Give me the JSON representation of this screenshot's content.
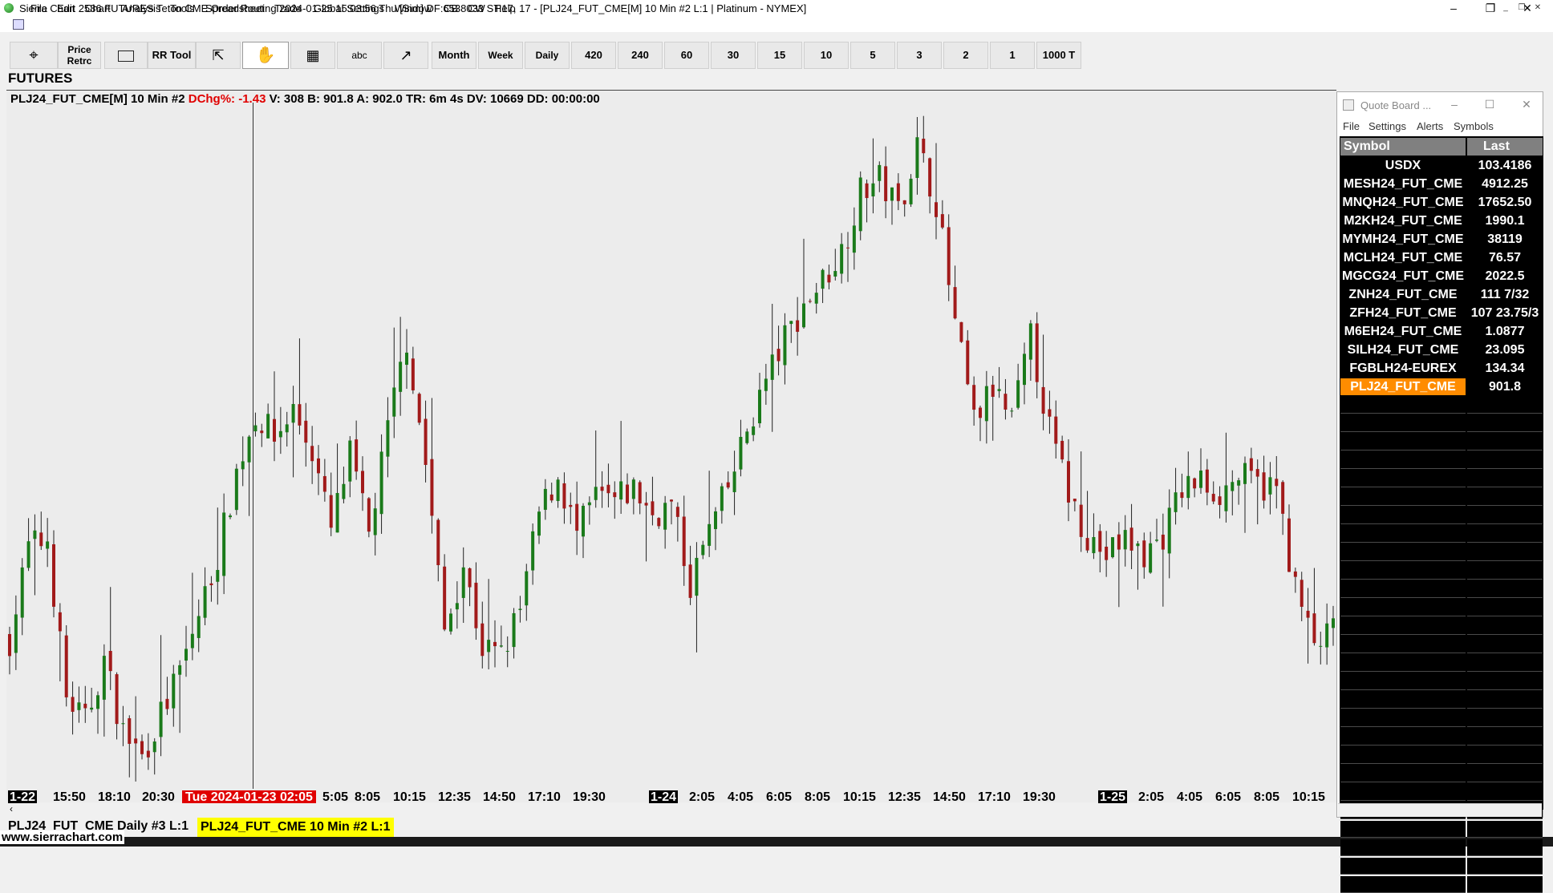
{
  "window": {
    "title": "Sierra Chart 2586 FUTURES Teton CME Order Routing 2024-01-25  15:03:56 Thu [Sim]  DF:6538033  ST:17, 17 - [PLJ24_FUT_CME[M]  10 Min  #2 L:1 | Platinum - NYMEX]",
    "minimize": "–",
    "maximize": "❐",
    "close": "✕"
  },
  "menu": {
    "items": [
      "File",
      "Edit",
      "Chart",
      "Analysis",
      "Tools",
      "Spreadsheet",
      "Trade",
      "Global Settings",
      "Window",
      "CB",
      "CW",
      "Help"
    ]
  },
  "toolbar": {
    "price_retrc_line1": "Price",
    "price_retrc_line2": "Retrc",
    "rr_tool": "RR Tool",
    "text_tool": "abc",
    "timeframes": [
      "Month",
      "Week",
      "Daily",
      "420",
      "240",
      "60",
      "30",
      "15",
      "10",
      "5",
      "3",
      "2",
      "1",
      "1000 T"
    ]
  },
  "chart": {
    "group_label": "FUTURES",
    "study_symbol": "PLJ24_FUT_CME[M]  10 Min  #2",
    "study_dchg": "DChg%: -1.43",
    "study_rest": "V: 308 B: 901.8 A: 902.0 TR: 6m 4s DV: 10669 DD: 00:00:00",
    "x_labels": [
      "1-22",
      "15:50",
      "18:10",
      "20:30",
      "Tue 2024-01-23  02:05",
      "5:05",
      "8:05",
      "10:15",
      "12:35",
      "14:50",
      "17:10",
      "19:30",
      "1-24",
      "2:05",
      "4:05",
      "6:05",
      "8:05",
      "10:15",
      "12:35",
      "14:50",
      "17:10",
      "19:30",
      "1-25",
      "2:05",
      "4:05",
      "6:05",
      "8:05",
      "10:15"
    ]
  },
  "chart_data": {
    "type": "candlestick",
    "symbol": "PLJ24_FUT_CME",
    "interval": "10 Min",
    "anchors": [
      [
        0,
        880
      ],
      [
        3,
        902
      ],
      [
        6,
        904
      ],
      [
        9,
        866
      ],
      [
        12,
        860
      ],
      [
        15,
        875
      ],
      [
        18,
        858
      ],
      [
        21,
        852
      ],
      [
        24,
        862
      ],
      [
        27,
        872
      ],
      [
        30,
        886
      ],
      [
        33,
        900
      ],
      [
        36,
        920
      ],
      [
        39,
        934
      ],
      [
        42,
        928
      ],
      [
        45,
        935
      ],
      [
        48,
        925
      ],
      [
        51,
        906
      ],
      [
        54,
        924
      ],
      [
        57,
        905
      ],
      [
        60,
        930
      ],
      [
        63,
        952
      ],
      [
        66,
        922
      ],
      [
        69,
        882
      ],
      [
        72,
        898
      ],
      [
        75,
        878
      ],
      [
        78,
        876
      ],
      [
        81,
        887
      ],
      [
        84,
        910
      ],
      [
        87,
        919
      ],
      [
        90,
        905
      ],
      [
        93,
        914
      ],
      [
        96,
        913
      ],
      [
        99,
        916
      ],
      [
        102,
        910
      ],
      [
        105,
        912
      ],
      [
        108,
        893
      ],
      [
        111,
        906
      ],
      [
        114,
        916
      ],
      [
        117,
        930
      ],
      [
        120,
        942
      ],
      [
        123,
        952
      ],
      [
        126,
        960
      ],
      [
        129,
        966
      ],
      [
        132,
        973
      ],
      [
        135,
        987
      ],
      [
        138,
        990
      ],
      [
        141,
        983
      ],
      [
        144,
        998
      ],
      [
        147,
        985
      ],
      [
        150,
        955
      ],
      [
        153,
        932
      ],
      [
        156,
        940
      ],
      [
        159,
        932
      ],
      [
        162,
        952
      ],
      [
        165,
        930
      ],
      [
        168,
        915
      ],
      [
        171,
        905
      ],
      [
        174,
        900
      ],
      [
        177,
        904
      ],
      [
        180,
        900
      ],
      [
        183,
        905
      ],
      [
        186,
        916
      ],
      [
        189,
        918
      ],
      [
        192,
        915
      ],
      [
        195,
        919
      ],
      [
        198,
        917
      ],
      [
        201,
        916
      ],
      [
        204,
        892
      ],
      [
        207,
        878
      ],
      [
        210,
        882
      ]
    ],
    "last": 901.8,
    "dchg_pct": -1.43
  },
  "status": {
    "tab1": "PLJ24_FUT_CME  Daily #3 L:1",
    "tab2": "PLJ24_FUT_CME  10 Min  #2 L:1",
    "website": "www.sierrachart.com"
  },
  "quote_board": {
    "title": "Quote Board ...",
    "menu": [
      "File",
      "Settings",
      "Alerts",
      "Symbols"
    ],
    "col_symbol": "Symbol",
    "col_last": "Last",
    "rows": [
      {
        "symbol": "USDX",
        "last": "103.4186"
      },
      {
        "symbol": "MESH24_FUT_CME",
        "last": "4912.25"
      },
      {
        "symbol": "MNQH24_FUT_CME",
        "last": "17652.50"
      },
      {
        "symbol": "M2KH24_FUT_CME",
        "last": "1990.1"
      },
      {
        "symbol": "MYMH24_FUT_CME",
        "last": "38119"
      },
      {
        "symbol": "MCLH24_FUT_CME",
        "last": "76.57"
      },
      {
        "symbol": "MGCG24_FUT_CME",
        "last": "2022.5"
      },
      {
        "symbol": "ZNH24_FUT_CME",
        "last": "111 7/32"
      },
      {
        "symbol": "ZFH24_FUT_CME",
        "last": "107 23.75/3"
      },
      {
        "symbol": "M6EH24_FUT_CME",
        "last": "1.0877"
      },
      {
        "symbol": "SILH24_FUT_CME",
        "last": "23.095"
      },
      {
        "symbol": "FGBLH24-EUREX",
        "last": "134.34"
      },
      {
        "symbol": "PLJ24_FUT_CME",
        "last": "901.8"
      }
    ]
  },
  "colors": {
    "up_candle": "#1a7a1a",
    "down_candle": "#a11a1a",
    "highlight": "#ff8c00",
    "tab_yellow": "#ffff00",
    "chart_bg": "#ececec"
  }
}
